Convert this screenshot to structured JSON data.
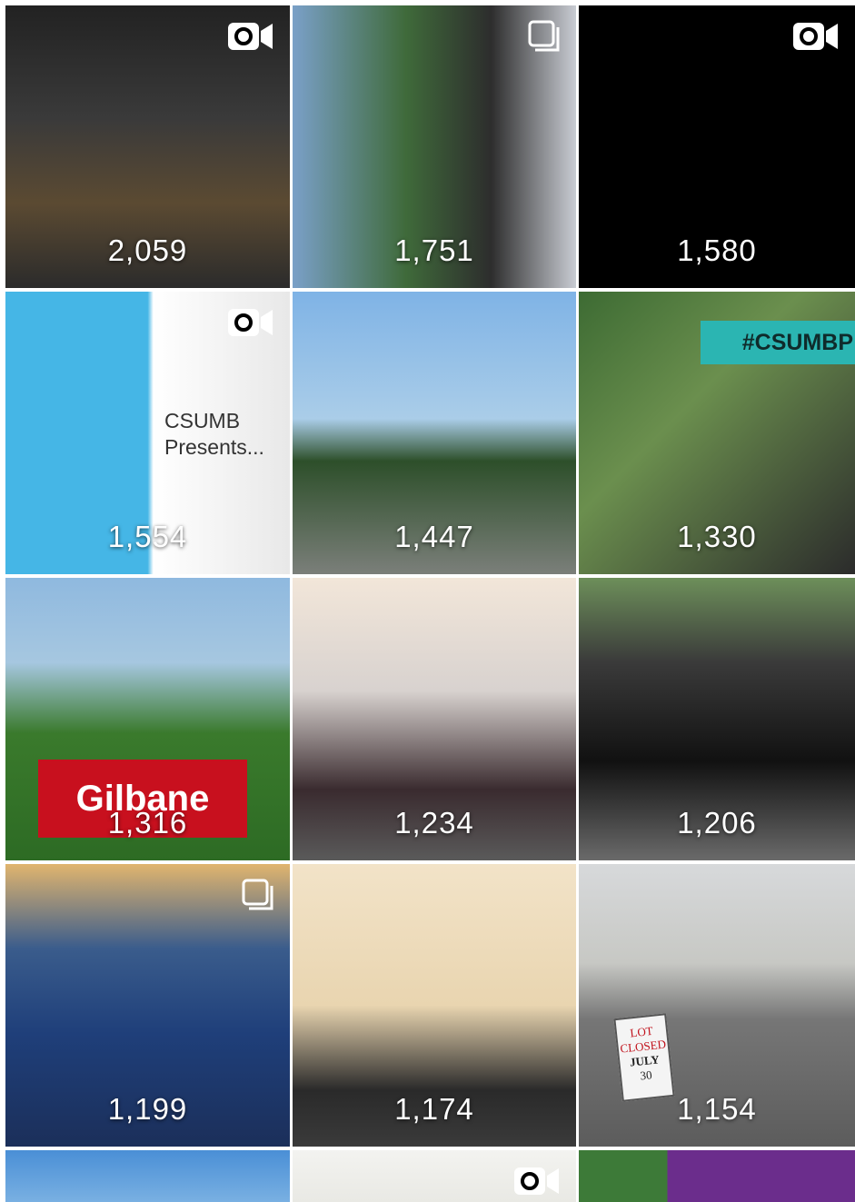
{
  "tiles": [
    {
      "count": "2,059",
      "badge": "video-icon",
      "bg": "linear-gradient(#222 0%, #3a3a3a 40%, #5b4a32 70%, #2b2b2b 100%)"
    },
    {
      "count": "1,751",
      "badge": "multi-photo-icon",
      "bg": "linear-gradient(90deg, #7aa0c8 0%, #3f6a3a 40%, #2d2d2d 70%, #c9ccd3 100%)"
    },
    {
      "count": "1,580",
      "badge": "video-icon",
      "bg": "#000000"
    },
    {
      "count": "1,554",
      "badge": "video-icon",
      "bg": "linear-gradient(90deg, #45b6e6 0%, #45b6e6 50%, #ffffff 52%, #e8e8e8 100%)",
      "overlay_lines": [
        "CSUMB",
        "Presents..."
      ]
    },
    {
      "count": "1,447",
      "badge": "",
      "bg": "linear-gradient(#7fb3e6 0%, #aacde8 45%, #2d4f2a 60%, #7b7f7a 100%)"
    },
    {
      "count": "1,330",
      "badge": "",
      "bg": "linear-gradient(135deg, #3d6b33 0%, #6b8f4e 40%, #2b2b2b 100%)",
      "tag": "#CSUMBP"
    },
    {
      "count": "1,316",
      "badge": "",
      "bg": "linear-gradient(#8fb9df 0%, #a6c7e0 30%, #3a7a2c 55%, #2d6b24 100%)",
      "banner": "Gilbane"
    },
    {
      "count": "1,234",
      "badge": "",
      "bg": "linear-gradient(#f2e6d9 0%, #d8d2cf 40%, #3a2b2f 75%, #5a5a5a 100%)"
    },
    {
      "count": "1,206",
      "badge": "",
      "bg": "linear-gradient(#6d8f5a 0%, #3a3a3a 30%, #111 65%, #6a6a6a 100%)"
    },
    {
      "count": "1,199",
      "badge": "multi-photo-icon",
      "bg": "linear-gradient(#e1b56e 0%, #3a5c8c 30%, #1f3f7a 60%, #1b2f5a 100%)"
    },
    {
      "count": "1,174",
      "badge": "",
      "bg": "linear-gradient(#f2e3c8 0%, #e9d5b0 50%, #2a2a2a 80%, #3a3a3a 100%)"
    },
    {
      "count": "1,154",
      "badge": "",
      "bg": "linear-gradient(#d7d9db 0%, #c7c8c4 35%, #767676 55%, #5c5c5c 100%)",
      "sign": [
        "LOT",
        "CLOSED",
        "JULY",
        "30"
      ]
    },
    {
      "count": "",
      "badge": "",
      "bg": "linear-gradient(#4a8fd6 0%, #79b0e2 100%)"
    },
    {
      "count": "",
      "badge": "video-icon",
      "bg": "linear-gradient(#f3f3f0 0%, #e9e9e4 100%)"
    },
    {
      "count": "",
      "badge": "",
      "bg": "linear-gradient(90deg, #3d7a38 0%, #3d7a38 32%, #6b2d8c 32%, #6b2d8c 100%)"
    }
  ]
}
